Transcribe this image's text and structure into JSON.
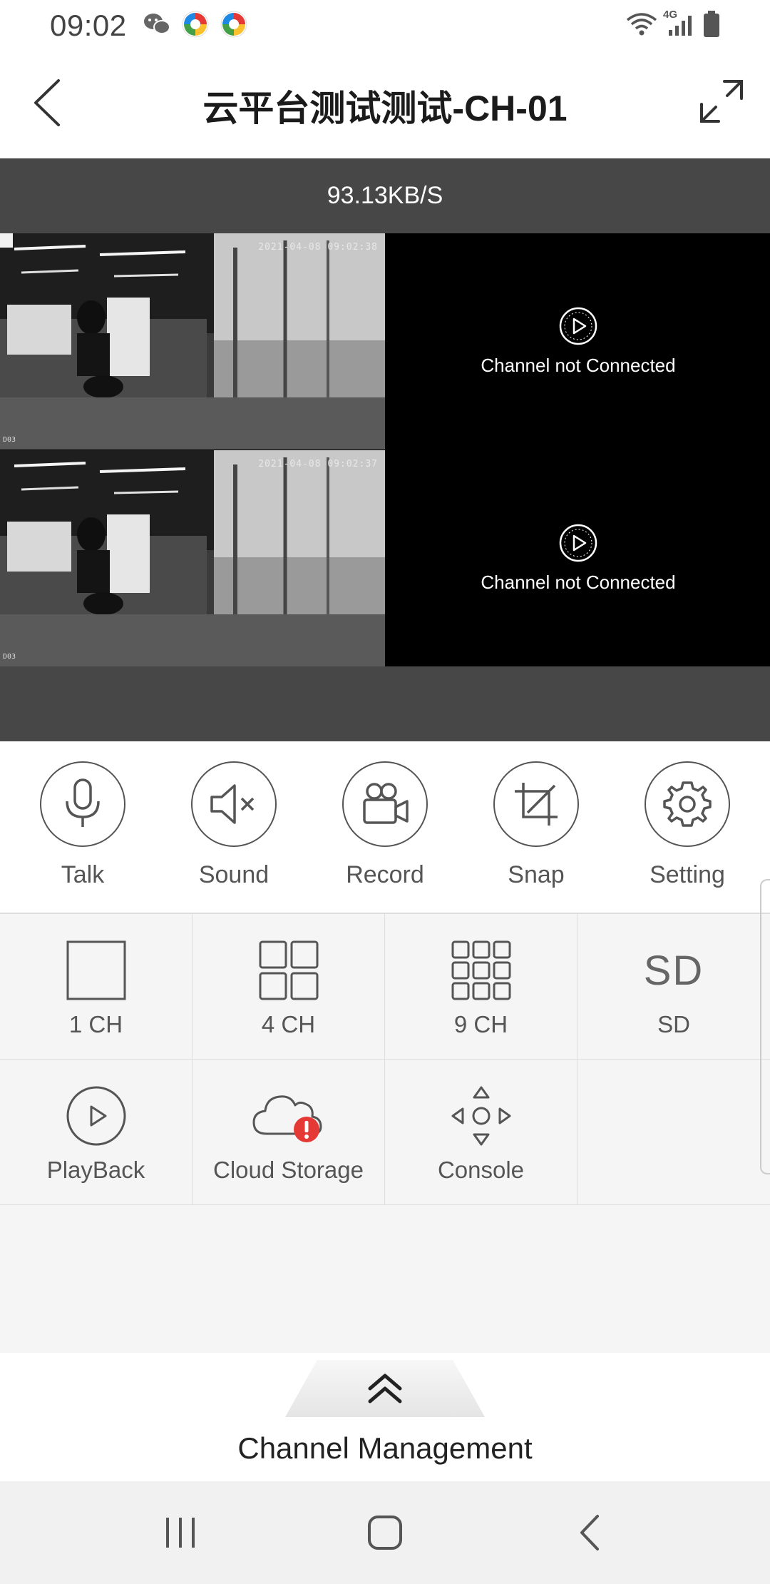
{
  "status_bar": {
    "time": "09:02",
    "notification_icons": [
      "wechat-icon",
      "app-icon",
      "app-icon"
    ],
    "network": "4G"
  },
  "header": {
    "title": "云平台测试测试-CH-01"
  },
  "video": {
    "bitrate": "93.13KB/S",
    "channels": [
      {
        "status": "connected",
        "timestamp": "2021-04-08 09:02:38",
        "label": "D03"
      },
      {
        "status": "disconnected",
        "message": "Channel not Connected"
      },
      {
        "status": "connected",
        "timestamp": "2021-04-08 09:02:37",
        "label": "D03"
      },
      {
        "status": "disconnected",
        "message": "Channel not Connected"
      }
    ]
  },
  "actions": [
    {
      "label": "Talk",
      "icon": "microphone-icon"
    },
    {
      "label": "Sound",
      "icon": "sound-muted-icon"
    },
    {
      "label": "Record",
      "icon": "video-camera-icon"
    },
    {
      "label": "Snap",
      "icon": "crop-icon"
    },
    {
      "label": "Setting",
      "icon": "gear-icon"
    }
  ],
  "tools": {
    "one_ch": "1 CH",
    "four_ch": "4 CH",
    "nine_ch": "9 CH",
    "sd_glyph": "SD",
    "sd": "SD",
    "playback": "PlayBack",
    "cloud_storage": "Cloud Storage",
    "console": "Console"
  },
  "channel_management": {
    "label": "Channel Management"
  }
}
